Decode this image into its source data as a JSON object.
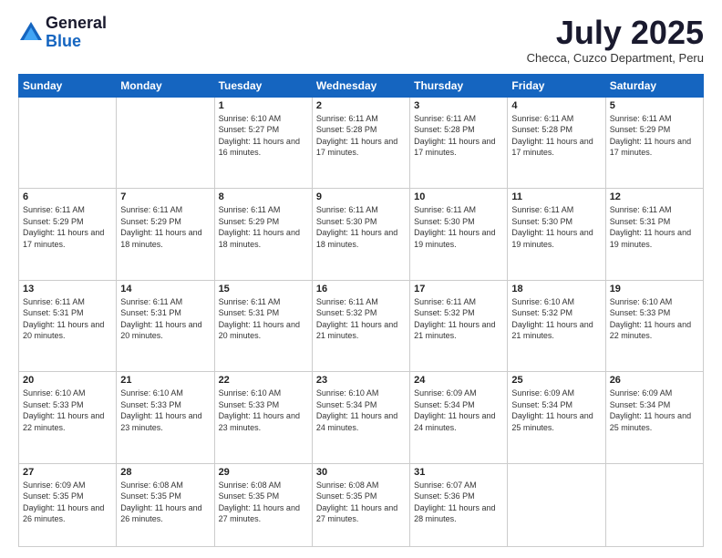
{
  "logo": {
    "general": "General",
    "blue": "Blue"
  },
  "header": {
    "month": "July 2025",
    "location": "Checca, Cuzco Department, Peru"
  },
  "weekdays": [
    "Sunday",
    "Monday",
    "Tuesday",
    "Wednesday",
    "Thursday",
    "Friday",
    "Saturday"
  ],
  "weeks": [
    [
      null,
      null,
      {
        "day": 1,
        "sunrise": "6:10 AM",
        "sunset": "5:27 PM",
        "daylight": "11 hours and 16 minutes."
      },
      {
        "day": 2,
        "sunrise": "6:11 AM",
        "sunset": "5:28 PM",
        "daylight": "11 hours and 17 minutes."
      },
      {
        "day": 3,
        "sunrise": "6:11 AM",
        "sunset": "5:28 PM",
        "daylight": "11 hours and 17 minutes."
      },
      {
        "day": 4,
        "sunrise": "6:11 AM",
        "sunset": "5:28 PM",
        "daylight": "11 hours and 17 minutes."
      },
      {
        "day": 5,
        "sunrise": "6:11 AM",
        "sunset": "5:29 PM",
        "daylight": "11 hours and 17 minutes."
      }
    ],
    [
      {
        "day": 6,
        "sunrise": "6:11 AM",
        "sunset": "5:29 PM",
        "daylight": "11 hours and 17 minutes."
      },
      {
        "day": 7,
        "sunrise": "6:11 AM",
        "sunset": "5:29 PM",
        "daylight": "11 hours and 18 minutes."
      },
      {
        "day": 8,
        "sunrise": "6:11 AM",
        "sunset": "5:29 PM",
        "daylight": "11 hours and 18 minutes."
      },
      {
        "day": 9,
        "sunrise": "6:11 AM",
        "sunset": "5:30 PM",
        "daylight": "11 hours and 18 minutes."
      },
      {
        "day": 10,
        "sunrise": "6:11 AM",
        "sunset": "5:30 PM",
        "daylight": "11 hours and 19 minutes."
      },
      {
        "day": 11,
        "sunrise": "6:11 AM",
        "sunset": "5:30 PM",
        "daylight": "11 hours and 19 minutes."
      },
      {
        "day": 12,
        "sunrise": "6:11 AM",
        "sunset": "5:31 PM",
        "daylight": "11 hours and 19 minutes."
      }
    ],
    [
      {
        "day": 13,
        "sunrise": "6:11 AM",
        "sunset": "5:31 PM",
        "daylight": "11 hours and 20 minutes."
      },
      {
        "day": 14,
        "sunrise": "6:11 AM",
        "sunset": "5:31 PM",
        "daylight": "11 hours and 20 minutes."
      },
      {
        "day": 15,
        "sunrise": "6:11 AM",
        "sunset": "5:31 PM",
        "daylight": "11 hours and 20 minutes."
      },
      {
        "day": 16,
        "sunrise": "6:11 AM",
        "sunset": "5:32 PM",
        "daylight": "11 hours and 21 minutes."
      },
      {
        "day": 17,
        "sunrise": "6:11 AM",
        "sunset": "5:32 PM",
        "daylight": "11 hours and 21 minutes."
      },
      {
        "day": 18,
        "sunrise": "6:10 AM",
        "sunset": "5:32 PM",
        "daylight": "11 hours and 21 minutes."
      },
      {
        "day": 19,
        "sunrise": "6:10 AM",
        "sunset": "5:33 PM",
        "daylight": "11 hours and 22 minutes."
      }
    ],
    [
      {
        "day": 20,
        "sunrise": "6:10 AM",
        "sunset": "5:33 PM",
        "daylight": "11 hours and 22 minutes."
      },
      {
        "day": 21,
        "sunrise": "6:10 AM",
        "sunset": "5:33 PM",
        "daylight": "11 hours and 23 minutes."
      },
      {
        "day": 22,
        "sunrise": "6:10 AM",
        "sunset": "5:33 PM",
        "daylight": "11 hours and 23 minutes."
      },
      {
        "day": 23,
        "sunrise": "6:10 AM",
        "sunset": "5:34 PM",
        "daylight": "11 hours and 24 minutes."
      },
      {
        "day": 24,
        "sunrise": "6:09 AM",
        "sunset": "5:34 PM",
        "daylight": "11 hours and 24 minutes."
      },
      {
        "day": 25,
        "sunrise": "6:09 AM",
        "sunset": "5:34 PM",
        "daylight": "11 hours and 25 minutes."
      },
      {
        "day": 26,
        "sunrise": "6:09 AM",
        "sunset": "5:34 PM",
        "daylight": "11 hours and 25 minutes."
      }
    ],
    [
      {
        "day": 27,
        "sunrise": "6:09 AM",
        "sunset": "5:35 PM",
        "daylight": "11 hours and 26 minutes."
      },
      {
        "day": 28,
        "sunrise": "6:08 AM",
        "sunset": "5:35 PM",
        "daylight": "11 hours and 26 minutes."
      },
      {
        "day": 29,
        "sunrise": "6:08 AM",
        "sunset": "5:35 PM",
        "daylight": "11 hours and 27 minutes."
      },
      {
        "day": 30,
        "sunrise": "6:08 AM",
        "sunset": "5:35 PM",
        "daylight": "11 hours and 27 minutes."
      },
      {
        "day": 31,
        "sunrise": "6:07 AM",
        "sunset": "5:36 PM",
        "daylight": "11 hours and 28 minutes."
      },
      null,
      null
    ]
  ],
  "labels": {
    "sunrise": "Sunrise:",
    "sunset": "Sunset:",
    "daylight": "Daylight:"
  }
}
